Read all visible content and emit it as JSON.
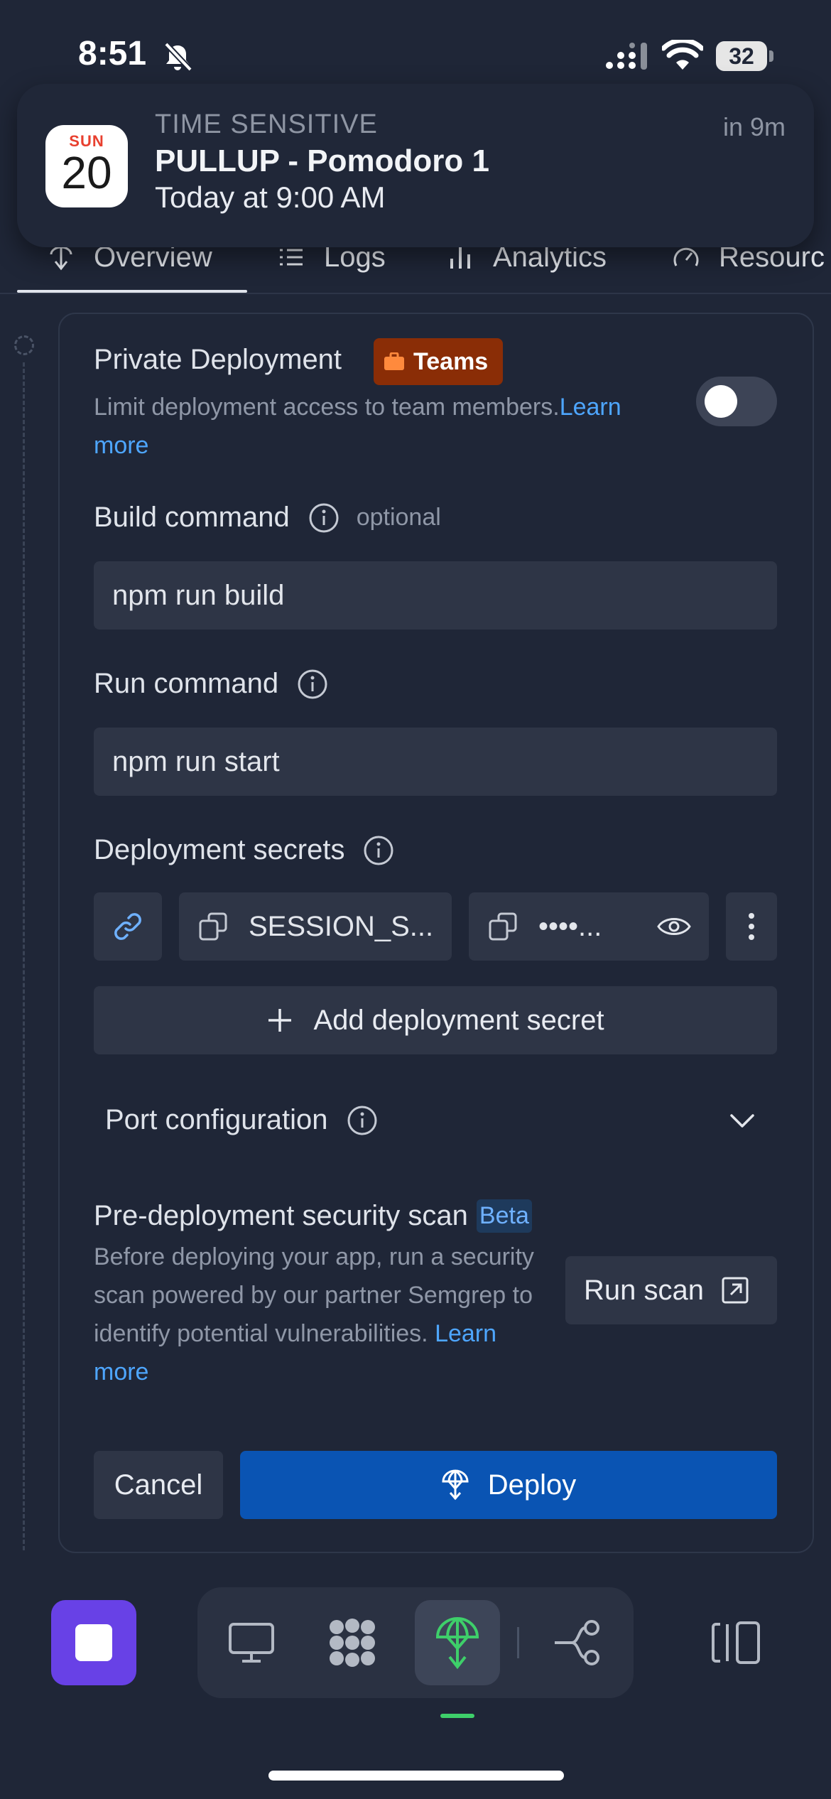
{
  "status_bar": {
    "time": "8:51",
    "battery": "32"
  },
  "notification": {
    "calendar_day": "SUN",
    "calendar_date": "20",
    "label": "TIME SENSITIVE",
    "title": "PULLUP - Pomodoro 1",
    "body": "Today at 9:00 AM",
    "time": "in 9m"
  },
  "tabs": [
    {
      "label": "Overview",
      "icon": "deploy-icon"
    },
    {
      "label": "Logs",
      "icon": "list-icon"
    },
    {
      "label": "Analytics",
      "icon": "bar-chart-icon"
    },
    {
      "label": "Resourc",
      "icon": "gauge-icon"
    }
  ],
  "private_deployment": {
    "title": "Private Deployment",
    "badge": "Teams",
    "description": "Limit deployment access to team members.",
    "learn_more": "Learn more",
    "enabled": false
  },
  "build_command": {
    "label": "Build command",
    "optional": "optional",
    "value": "npm run build"
  },
  "run_command": {
    "label": "Run command",
    "value": "npm run start"
  },
  "deployment_secrets": {
    "label": "Deployment secrets",
    "key": "SESSION_S...",
    "value": "••••...",
    "add_label": "Add deployment secret"
  },
  "port_configuration": {
    "label": "Port configuration"
  },
  "security_scan": {
    "title": "Pre-deployment security scan",
    "badge": "Beta",
    "description": "Before deploying your app, run a security scan powered by our partner Semgrep to identify potential vulnerabilities.",
    "learn_more": "Learn more",
    "button": "Run scan"
  },
  "actions": {
    "cancel": "Cancel",
    "deploy": "Deploy"
  },
  "colors": {
    "background": "#1f2637",
    "accent": "#0a54b3",
    "link": "#4ea6ff",
    "teams_badge": "#8a2d06",
    "stop_button": "#6841e6",
    "active_indicator": "#3ecf6a"
  }
}
